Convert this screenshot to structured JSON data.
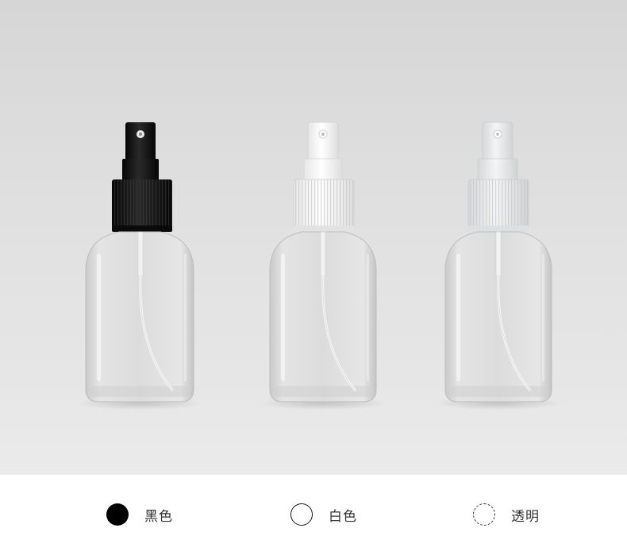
{
  "product_photo": {
    "variants": [
      {
        "id": "black",
        "cap_color": "#0b0b0b",
        "collar_color": "#111111"
      },
      {
        "id": "white",
        "cap_color": "#f7f7f7",
        "collar_color": "#f3f3f3"
      },
      {
        "id": "clear",
        "cap_color": "#eef0f1",
        "collar_color": "#e9ecee"
      }
    ]
  },
  "color_options": [
    {
      "label": "黑色",
      "swatch": "filled-black"
    },
    {
      "label": "白色",
      "swatch": "outline-white"
    },
    {
      "label": "透明",
      "swatch": "dashed-clear"
    }
  ]
}
